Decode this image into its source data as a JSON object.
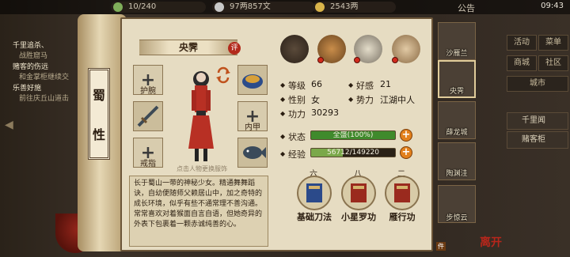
{
  "topbar": {
    "stamina": "10/240",
    "silver": "97两857文",
    "gold": "2543两",
    "notice": "公告",
    "clock": "09:43"
  },
  "quests": [
    {
      "title": "千里追杀、",
      "desc": "战胜窟马"
    },
    {
      "title": "赌客的伤远",
      "desc": "和金掌柜继续交"
    },
    {
      "title": "乐善好施",
      "desc": "前往庆丘山道击"
    }
  ],
  "side_menu": {
    "activity": "活动",
    "ranking": "菜单",
    "shop": "商城",
    "social": "社区",
    "city": "城市"
  },
  "side_tabs": [
    "千里闻",
    "赌客柜"
  ],
  "scroll_title": [
    "蜀",
    "性"
  ],
  "character": {
    "name": "央霁",
    "rate_badge": "评",
    "portrait_hint": "点击人物更换服饰",
    "equipment": {
      "wrist": "护腕",
      "armor": "内甲",
      "ring": "戒指"
    },
    "bio": "长于蜀山一带的神秘少女。精通舞舞蹈诀，自幼便随师父赖居山中，加之奇特的成长环境，似乎有些不通常理不善沟通。常常喜欢对着猴面自言自语，但她奇异的外表下包裹着一颗赤诚纯善的心。"
  },
  "stats": {
    "level_label": "等级",
    "level": "66",
    "favor_label": "好感",
    "favor": "21",
    "gender_label": "性别",
    "gender": "女",
    "faction_label": "势力",
    "faction": "江湖中人",
    "power_label": "功力",
    "power": "30293",
    "status_label": "状态",
    "status_text": "全盛(100%)",
    "status_fraction": 1.0,
    "exp_label": "经验",
    "exp_text": "56712/149220",
    "exp_fraction": 0.38
  },
  "skills": [
    {
      "level": "六",
      "name": "基础刀法"
    },
    {
      "level": "八",
      "name": "小星罗功"
    },
    {
      "level": "二",
      "name": "雁行功"
    }
  ],
  "char_list": [
    {
      "name": "沙雁兰",
      "selected": false
    },
    {
      "name": "央霁",
      "selected": true
    },
    {
      "name": "薛龙城",
      "selected": false
    },
    {
      "name": "陶渊洼",
      "selected": false
    },
    {
      "name": "步惊云",
      "selected": false
    }
  ],
  "list_badge": "件",
  "close_seal": "离开",
  "colors": {
    "status_bar": "#3f8a2c",
    "exp_bar": "#7aa84a",
    "accent_red": "#b32a1c",
    "plus_orange": "#e2801c"
  }
}
